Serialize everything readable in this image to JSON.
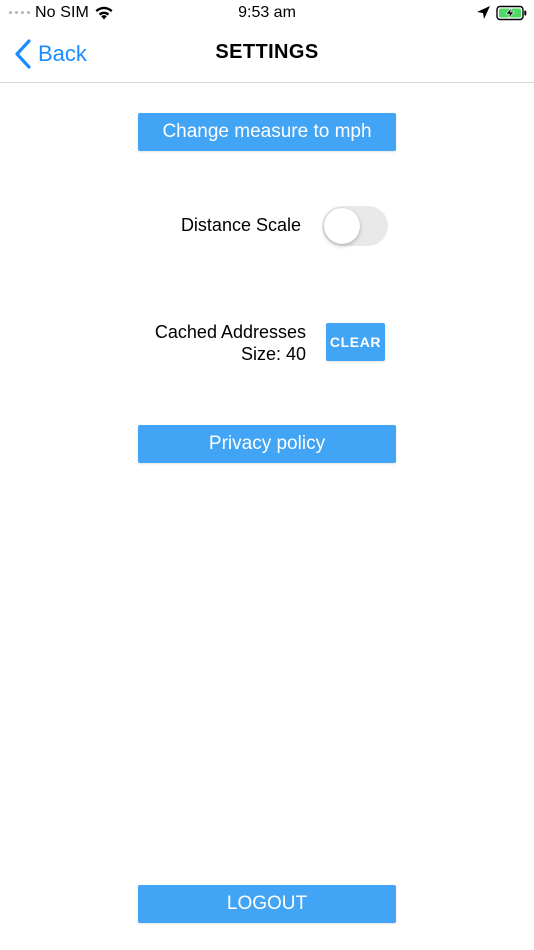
{
  "status_bar": {
    "carrier": "No SIM",
    "time": "9:53 am",
    "icons": [
      "signal-dots-icon",
      "wifi-icon",
      "location-arrow-icon",
      "battery-charging-icon"
    ],
    "battery_color": "#4cd964"
  },
  "nav": {
    "back_label": "Back",
    "title": "SETTINGS",
    "back_icon": "chevron-left-icon",
    "accent_color": "#1a8cff"
  },
  "settings": {
    "measure_button_label": "Change measure to mph",
    "distance_scale_label": "Distance Scale",
    "distance_scale_on": false,
    "cached_addresses_label": "Cached Addresses",
    "cached_size_label": "Size: 40",
    "clear_button_label": "CLEAR",
    "privacy_button_label": "Privacy policy",
    "logout_button_label": "LOGOUT",
    "button_color": "#41a4f4"
  }
}
